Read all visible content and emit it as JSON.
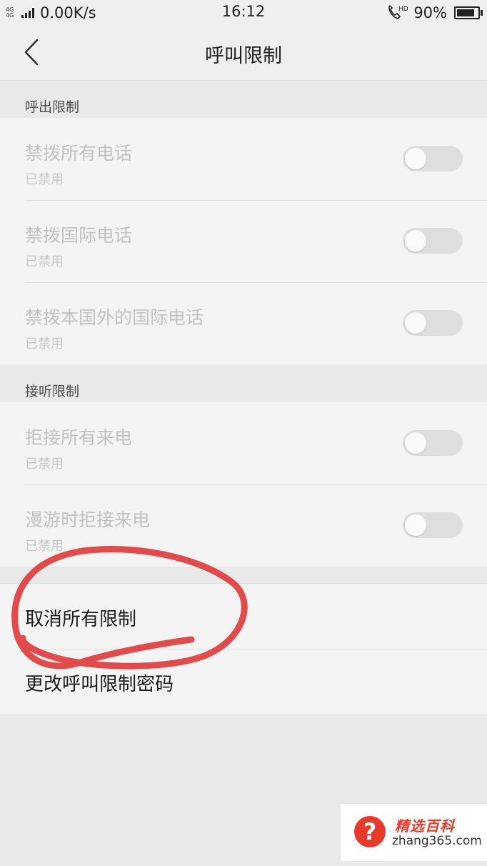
{
  "status_bar": {
    "network_indicator": "4G 4G",
    "speed": "0.00K/s",
    "time": "16:12",
    "call_icon": "phone-hd-icon",
    "call_icon_label": "HD",
    "battery_percent": "90%",
    "battery_level": 0.9
  },
  "header": {
    "back_icon": "chevron-left-icon",
    "title": "呼叫限制"
  },
  "outgoing": {
    "header": "呼出限制",
    "items": [
      {
        "label": "禁拨所有电话",
        "status": "已禁用",
        "enabled": false
      },
      {
        "label": "禁拨国际电话",
        "status": "已禁用",
        "enabled": false
      },
      {
        "label": "禁拨本国外的国际电话",
        "status": "已禁用",
        "enabled": false
      }
    ]
  },
  "incoming": {
    "header": "接听限制",
    "items": [
      {
        "label": "拒接所有来电",
        "status": "已禁用",
        "enabled": false
      },
      {
        "label": "漫游时拒接来电",
        "status": "已禁用",
        "enabled": false
      }
    ]
  },
  "actions": {
    "cancel_all": "取消所有限制",
    "change_password": "更改呼叫限制密码"
  },
  "annotation": {
    "color": "#e03c3c",
    "target": "取消所有限制"
  },
  "watermark": {
    "title": "精选百科",
    "site": "zhang365.com",
    "color": "#e83a2a",
    "icon_char": "?"
  }
}
